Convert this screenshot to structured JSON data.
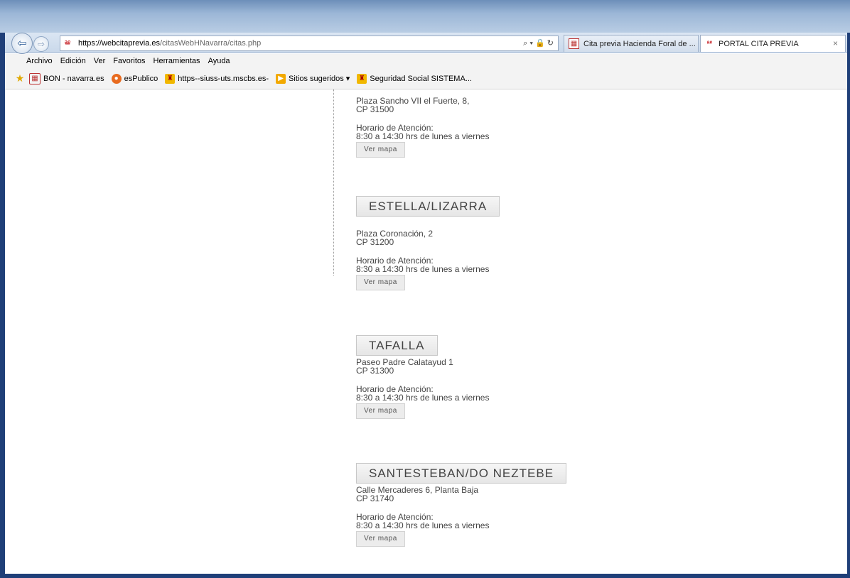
{
  "browser": {
    "url_host": "https://webcitaprevia.es",
    "url_path": "/citasWebHNavarra/citas.php",
    "url_tools": "⌕ ▾ 🔒 ↻",
    "tabs": [
      {
        "label": "Cita previa Hacienda Foral de ..."
      },
      {
        "label": "PORTAL CITA PREVIA"
      }
    ],
    "tab_close": "×"
  },
  "menu": [
    "Archivo",
    "Edición",
    "Ver",
    "Favoritos",
    "Herramientas",
    "Ayuda"
  ],
  "favorites": [
    {
      "label": "BON - navarra.es"
    },
    {
      "label": "esPublico"
    },
    {
      "label": "https--siuss-uts.mscbs.es-"
    },
    {
      "label": "Sitios sugeridos ▾"
    },
    {
      "label": "Seguridad Social SISTEMA..."
    }
  ],
  "offices": [
    {
      "name": "",
      "address": "Plaza Sancho VII el Fuerte, 8,",
      "cp": "CP 31500",
      "hours_label": "Horario de Atención:",
      "hours": "8:30 a 14:30 hrs de lunes a viernes",
      "map_button": "Ver mapa"
    },
    {
      "name": "ESTELLA/LIZARRA",
      "address": "Plaza Coronación, 2",
      "cp": "CP 31200",
      "hours_label": "Horario de Atención:",
      "hours": "8:30 a 14:30 hrs de lunes a viernes",
      "map_button": "Ver mapa"
    },
    {
      "name": "TAFALLA",
      "address": "Paseo Padre Calatayud 1",
      "cp": "CP 31300",
      "hours_label": "Horario de Atención:",
      "hours": "8:30 a 14:30 hrs de lunes a viernes",
      "map_button": "Ver mapa"
    },
    {
      "name": "SANTESTEBAN/DO NEZTEBE",
      "address": "Calle Mercaderes 6, Planta Baja",
      "cp": "CP 31740",
      "hours_label": "Horario de Atención:",
      "hours": "8:30 a 14:30 hrs de lunes a viernes",
      "map_button": "Ver mapa"
    }
  ]
}
